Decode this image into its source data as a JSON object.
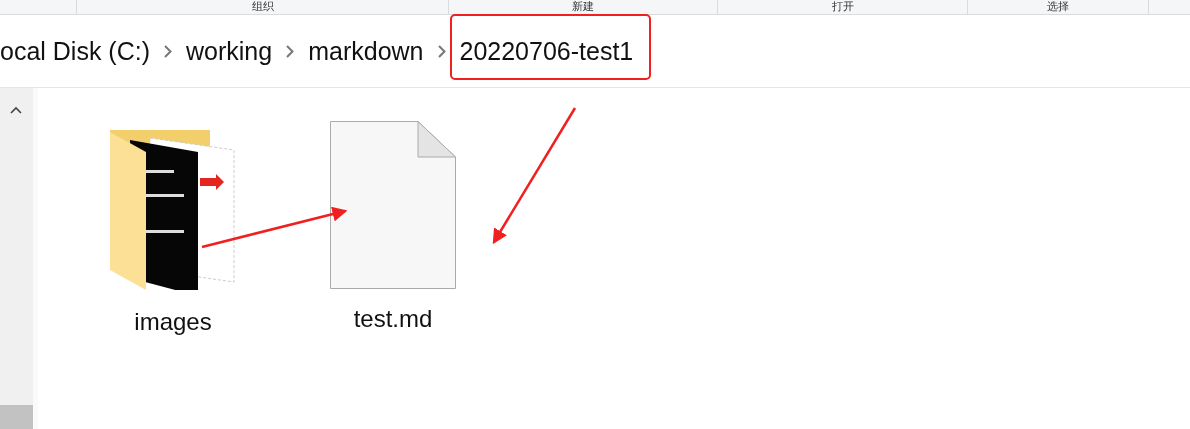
{
  "ribbon": {
    "groups": [
      {
        "label": "组织"
      },
      {
        "label": "新建"
      },
      {
        "label": "打开"
      },
      {
        "label": "选择"
      }
    ]
  },
  "breadcrumb": {
    "items": [
      {
        "label": "ocal Disk (C:)"
      },
      {
        "label": "working"
      },
      {
        "label": "markdown"
      },
      {
        "label": "20220706-test1"
      }
    ]
  },
  "files": [
    {
      "name": "images",
      "kind": "folder"
    },
    {
      "name": "test.md",
      "kind": "file"
    }
  ]
}
